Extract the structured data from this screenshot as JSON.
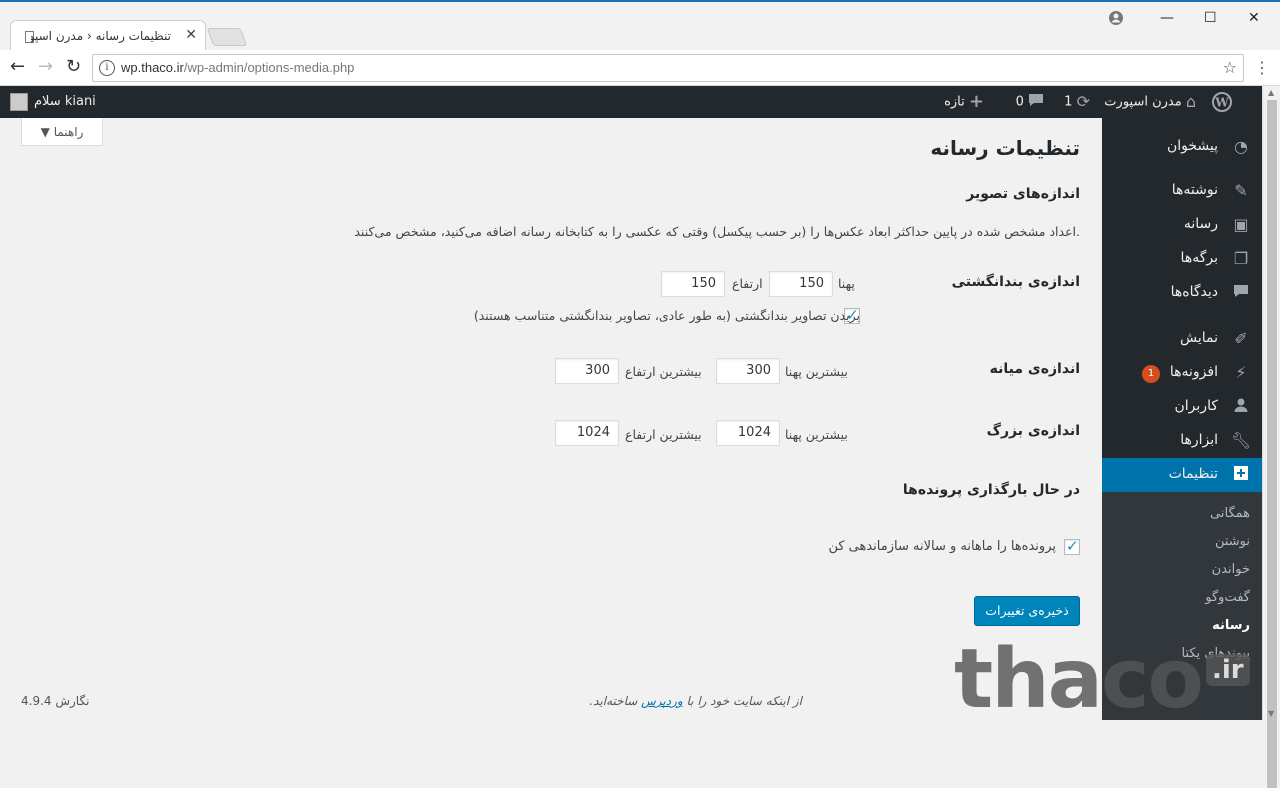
{
  "browser": {
    "tab_title": "تنظیمات رسانه ‹ مدرن اسپورت",
    "url_domain": "wp.thaco.ir",
    "url_path": "/wp-admin/options-media.php"
  },
  "adminbar": {
    "greeting": "سلام kiani",
    "site_name": "مدرن اسپورت",
    "updates_count": "1",
    "comments_count": "0",
    "new_label": "تازه"
  },
  "help_tab": "راهنما",
  "menu": {
    "items": [
      {
        "label": "پیشخوان",
        "icon": "dashboard-icon"
      },
      {
        "label": "نوشته‌ها",
        "icon": "pin-icon"
      },
      {
        "label": "رسانه",
        "icon": "media-icon"
      },
      {
        "label": "برگه‌ها",
        "icon": "pages-icon"
      },
      {
        "label": "دیدگاه‌ها",
        "icon": "comment-icon"
      },
      {
        "label": "نمایش",
        "icon": "appearance-icon"
      },
      {
        "label": "افزونه‌ها",
        "icon": "plugin-icon",
        "badge": "1"
      },
      {
        "label": "کاربران",
        "icon": "user-icon"
      },
      {
        "label": "ابزارها",
        "icon": "wrench-icon"
      },
      {
        "label": "تنظیمات",
        "icon": "settings-icon"
      }
    ],
    "submenu": [
      "همگانی",
      "نوشتن",
      "خواندن",
      "گفت‌وگو",
      "رسانه",
      "پیوندهای یکتا"
    ]
  },
  "page": {
    "title": "تنظیمات رسانه",
    "image_sizes_title": "اندازه‌های تصویر",
    "image_sizes_desc": "اعداد مشخص شده در پایین حداکثر ابعاد عکس‌ها را (بر حسب پیکسل) وقتی که عکسی را به کتابخانه رسانه اضافه می‌کنید، مشخص می‌کنند.",
    "thumbnail": {
      "label": "اندازه‌ی بندانگشتی",
      "width_label": "پهنا",
      "width": "150",
      "height_label": "ارتفاع",
      "height": "150",
      "crop_label": "بریدن تصاویر بندانگشتی (به طور عادی، تصاویر بندانگشتی متناسب هستند)"
    },
    "medium": {
      "label": "اندازه‌ی میانه",
      "width_label": "بیشترین پهنا",
      "width": "300",
      "height_label": "بیشترین ارتفاع",
      "height": "300"
    },
    "large": {
      "label": "اندازه‌ی بزرگ",
      "width_label": "بیشترین پهنا",
      "width": "1024",
      "height_label": "بیشترین ارتفاع",
      "height": "1024"
    },
    "uploads_title": "در حال بارگذاری پرونده‌ها",
    "uploads_label": "پرونده‌ها را ماهانه و سالانه سازماندهی کن",
    "save_button": "ذخیره‌ی تغییرات"
  },
  "footer": {
    "version": "4.9.4 نگارش",
    "thanks_prefix": "از اینکه سایت خود را با",
    "thanks_link": "وردپرس",
    "thanks_suffix": "ساخته‌اید."
  },
  "watermark": {
    "text": "thaco",
    "suffix": ".ir"
  }
}
